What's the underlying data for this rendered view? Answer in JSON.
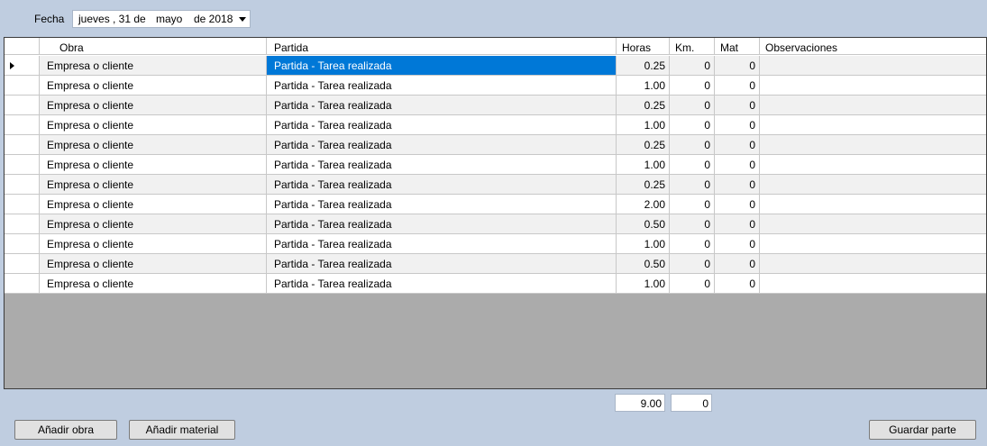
{
  "header": {
    "fecha_label": "Fecha",
    "date": {
      "weekday": "jueves",
      "day": ", 31 de",
      "month": "mayo",
      "year": "de 2018"
    }
  },
  "grid": {
    "columns": [
      "Obra",
      "Partida",
      "Horas",
      "Km.",
      "Mat",
      "Observaciones"
    ],
    "rows": [
      {
        "obra": "Empresa o cliente",
        "partida": "Partida - Tarea realizada",
        "horas": "0.25",
        "km": "0",
        "mat": "0",
        "obs": ""
      },
      {
        "obra": "Empresa o cliente",
        "partida": "Partida - Tarea realizada",
        "horas": "1.00",
        "km": "0",
        "mat": "0",
        "obs": ""
      },
      {
        "obra": "Empresa o cliente",
        "partida": "Partida - Tarea realizada",
        "horas": "0.25",
        "km": "0",
        "mat": "0",
        "obs": ""
      },
      {
        "obra": "Empresa o cliente",
        "partida": "Partida - Tarea realizada",
        "horas": "1.00",
        "km": "0",
        "mat": "0",
        "obs": ""
      },
      {
        "obra": "Empresa o cliente",
        "partida": "Partida - Tarea realizada",
        "horas": "0.25",
        "km": "0",
        "mat": "0",
        "obs": ""
      },
      {
        "obra": "Empresa o cliente",
        "partida": "Partida - Tarea realizada",
        "horas": "1.00",
        "km": "0",
        "mat": "0",
        "obs": ""
      },
      {
        "obra": "Empresa o cliente",
        "partida": "Partida - Tarea realizada",
        "horas": "0.25",
        "km": "0",
        "mat": "0",
        "obs": ""
      },
      {
        "obra": "Empresa o cliente",
        "partida": "Partida - Tarea realizada",
        "horas": "2.00",
        "km": "0",
        "mat": "0",
        "obs": ""
      },
      {
        "obra": "Empresa o cliente",
        "partida": "Partida - Tarea realizada",
        "horas": "0.50",
        "km": "0",
        "mat": "0",
        "obs": ""
      },
      {
        "obra": "Empresa o cliente",
        "partida": "Partida - Tarea realizada",
        "horas": "1.00",
        "km": "0",
        "mat": "0",
        "obs": ""
      },
      {
        "obra": "Empresa o cliente",
        "partida": "Partida - Tarea realizada",
        "horas": "0.50",
        "km": "0",
        "mat": "0",
        "obs": ""
      },
      {
        "obra": "Empresa o cliente",
        "partida": "Partida - Tarea realizada",
        "horas": "1.00",
        "km": "0",
        "mat": "0",
        "obs": ""
      }
    ]
  },
  "totals": {
    "horas": "9.00",
    "km": "0"
  },
  "buttons": {
    "add_obra": "Añadir obra",
    "add_material": "Añadir material",
    "save": "Guardar parte"
  },
  "colors": {
    "background": "#bfcde0",
    "selection": "#0078d7",
    "grid_empty": "#ababab"
  }
}
